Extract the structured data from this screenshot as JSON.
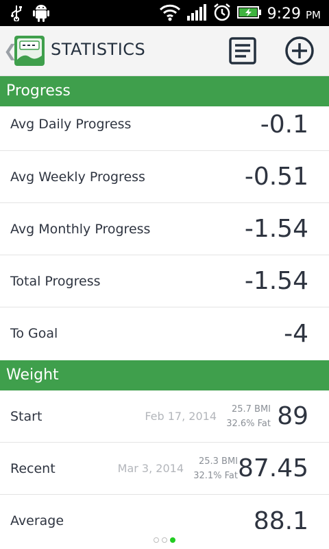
{
  "status_bar": {
    "time": "9:29",
    "ampm": "PM"
  },
  "action_bar": {
    "title": "STATISTICS",
    "icons": [
      "scale-icon",
      "list-icon",
      "add-icon"
    ]
  },
  "progress": {
    "header": "Progress",
    "rows": [
      {
        "label": "Avg Daily Progress",
        "value": "-0.1"
      },
      {
        "label": "Avg Weekly Progress",
        "value": "-0.51"
      },
      {
        "label": "Avg Monthly Progress",
        "value": "-1.54"
      },
      {
        "label": "Total Progress",
        "value": "-1.54"
      },
      {
        "label": "To Goal",
        "value": "-4"
      }
    ]
  },
  "weight": {
    "header": "Weight",
    "rows": [
      {
        "label": "Start",
        "date": "Feb 17, 2014",
        "bmi": "25.7 BMI",
        "fat": "32.6% Fat",
        "value": "89"
      },
      {
        "label": "Recent",
        "date": "Mar 3, 2014",
        "bmi": "25.3 BMI",
        "fat": "32.1% Fat",
        "value": "87.45"
      },
      {
        "label": "Average",
        "value": "88.1"
      }
    ]
  },
  "colors": {
    "accent": "#3f9f4c",
    "pager_active": "#22cc22"
  },
  "pager": {
    "count": 3,
    "active": 3
  }
}
